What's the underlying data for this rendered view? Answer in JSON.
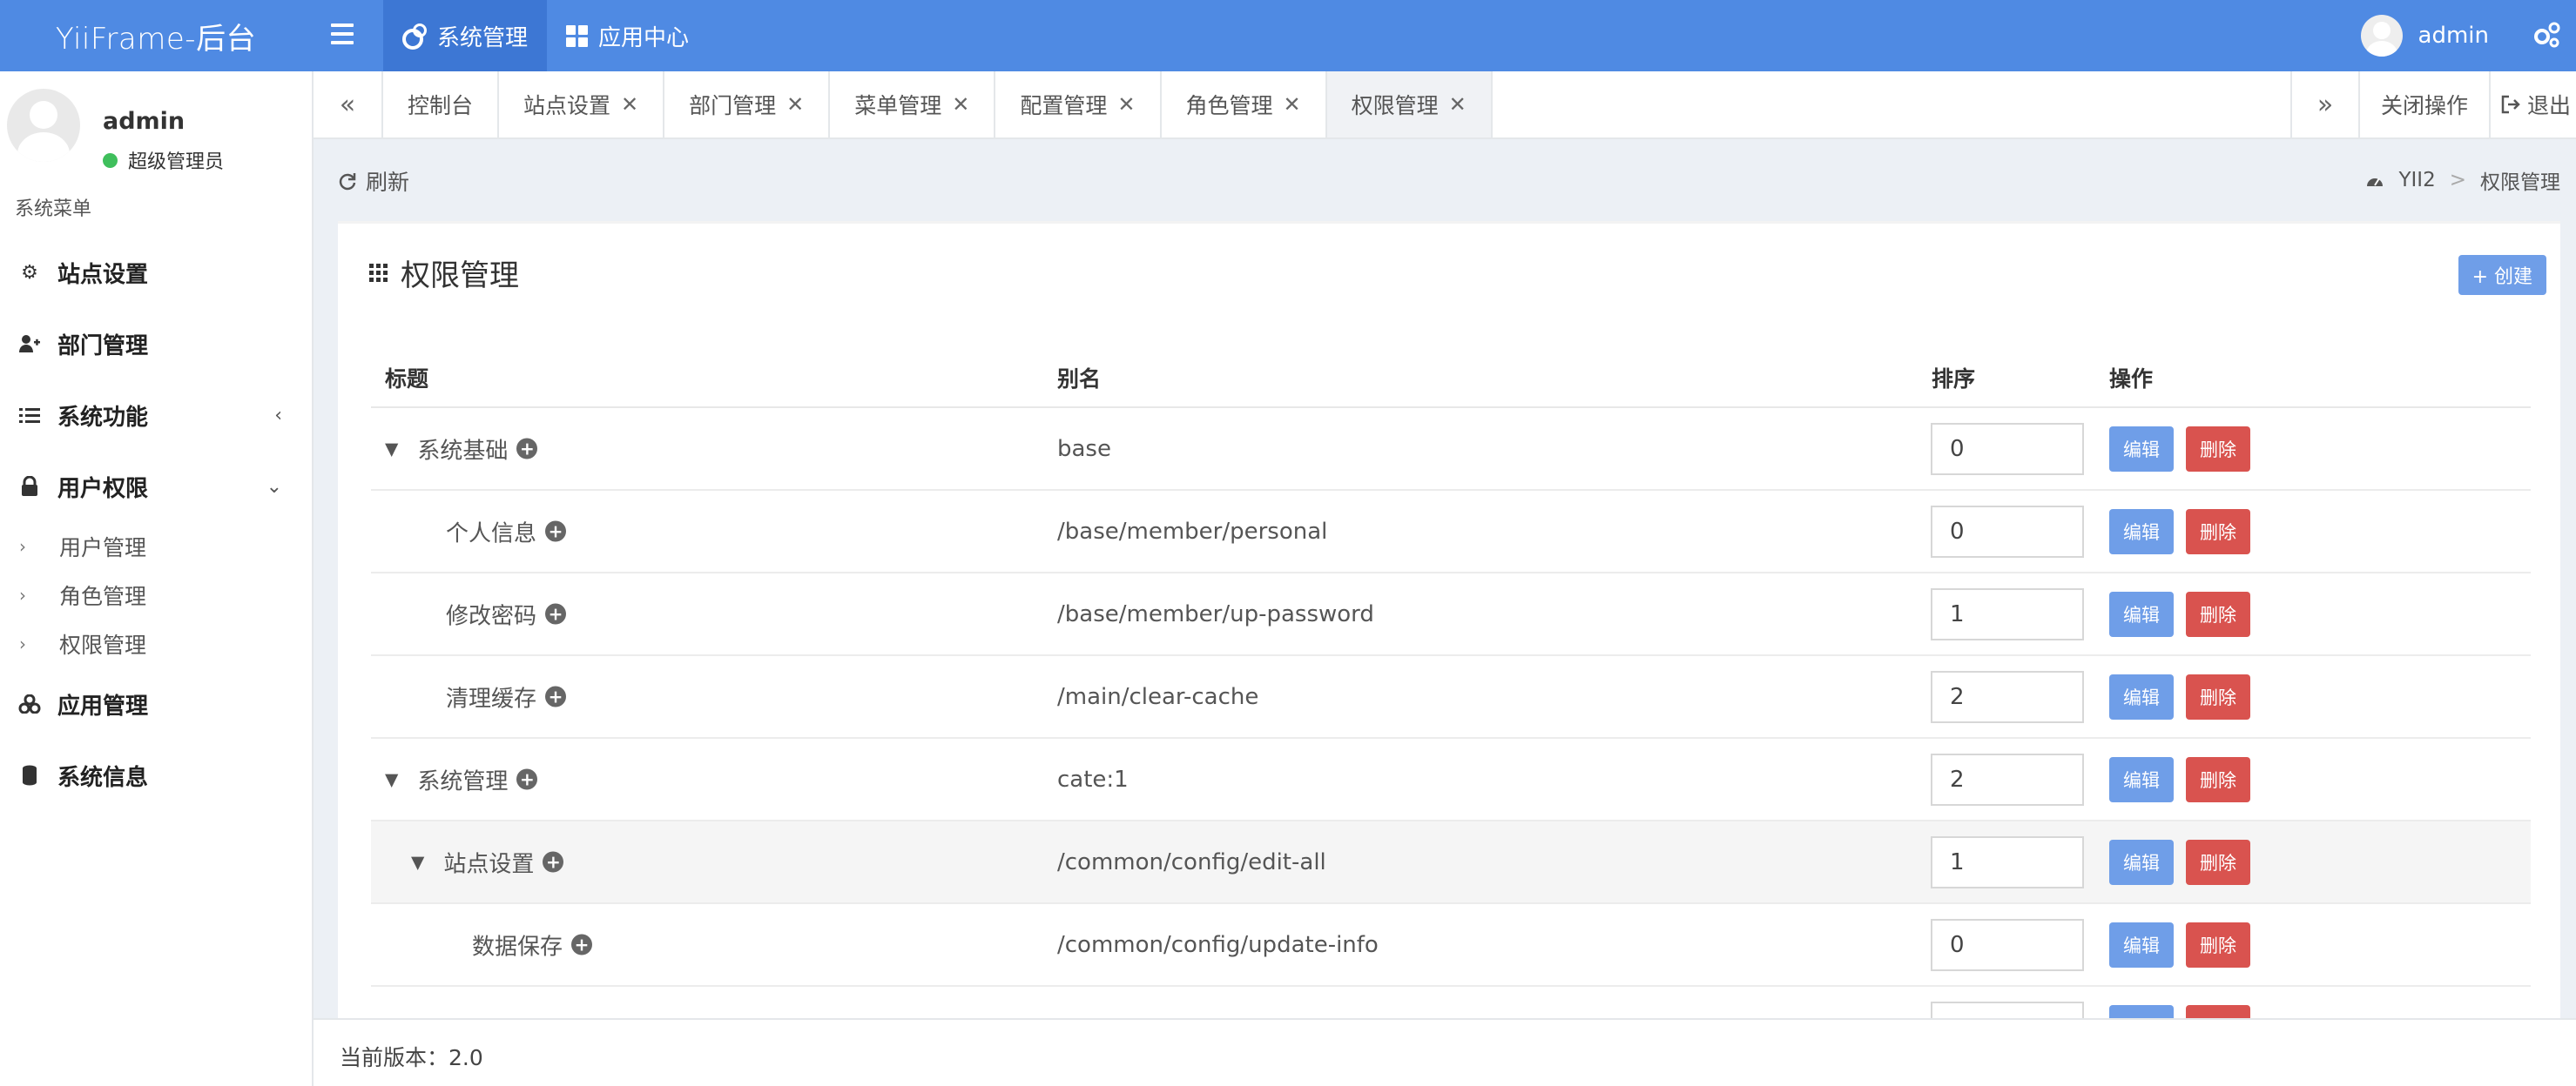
{
  "header": {
    "logo": "YiiFrame-后台",
    "nav": [
      {
        "label": "系统管理",
        "icon": "gears-icon",
        "active": true
      },
      {
        "label": "应用中心",
        "icon": "grid-icon",
        "active": false
      }
    ],
    "username": "admin"
  },
  "sidebar": {
    "user_name": "admin",
    "user_role": "超级管理员",
    "menu_header": "系统菜单",
    "items": [
      {
        "label": "站点设置",
        "icon": "gear-icon"
      },
      {
        "label": "部门管理",
        "icon": "user-plus-icon"
      },
      {
        "label": "系统功能",
        "icon": "list-icon",
        "caret": "‹"
      },
      {
        "label": "用户权限",
        "icon": "lock-icon",
        "caret": "⌄"
      },
      {
        "label": "应用管理",
        "icon": "cubes-icon"
      },
      {
        "label": "系统信息",
        "icon": "database-icon"
      }
    ],
    "subitems": [
      "用户管理",
      "角色管理",
      "权限管理"
    ]
  },
  "tabs": {
    "left_arrow": "«",
    "right_arrow": "»",
    "items": [
      "控制台",
      "站点设置",
      "部门管理",
      "菜单管理",
      "配置管理",
      "角色管理",
      "权限管理"
    ],
    "close_ops": "关闭操作",
    "logout": "退出"
  },
  "content": {
    "refresh": "刷新",
    "breadcrumb": [
      "YII2",
      ">",
      "权限管理"
    ],
    "box_title": "权限管理",
    "create_btn": "+ 创建",
    "columns": [
      "标题",
      "别名",
      "排序",
      "操作"
    ],
    "rows": [
      {
        "title": "系统基础",
        "alias": "base",
        "sort": "0",
        "level": 0,
        "expandable": true
      },
      {
        "title": "个人信息",
        "alias": "/base/member/personal",
        "sort": "0",
        "level": 1,
        "expandable": false
      },
      {
        "title": "修改密码",
        "alias": "/base/member/up-password",
        "sort": "1",
        "level": 1,
        "expandable": false
      },
      {
        "title": "清理缓存",
        "alias": "/main/clear-cache",
        "sort": "2",
        "level": 1,
        "expandable": false
      },
      {
        "title": "系统管理",
        "alias": "cate:1",
        "sort": "2",
        "level": 0,
        "expandable": true
      },
      {
        "title": "站点设置",
        "alias": "/common/config/edit-all",
        "sort": "1",
        "level": 1,
        "expandable": true,
        "highlight": true
      },
      {
        "title": "数据保存",
        "alias": "/common/config/update-info",
        "sort": "0",
        "level": 2,
        "expandable": false
      },
      {
        "title": "",
        "alias": "",
        "sort": "",
        "level": 2,
        "expandable": false
      }
    ],
    "edit_label": "编辑",
    "delete_label": "删除"
  },
  "footer": {
    "version": "当前版本：2.0"
  },
  "colors": {
    "primary": "#4f8ae3",
    "edit_btn": "#6f9ee8",
    "delete_btn": "#d9534f",
    "status_online": "#3fbf5c"
  }
}
